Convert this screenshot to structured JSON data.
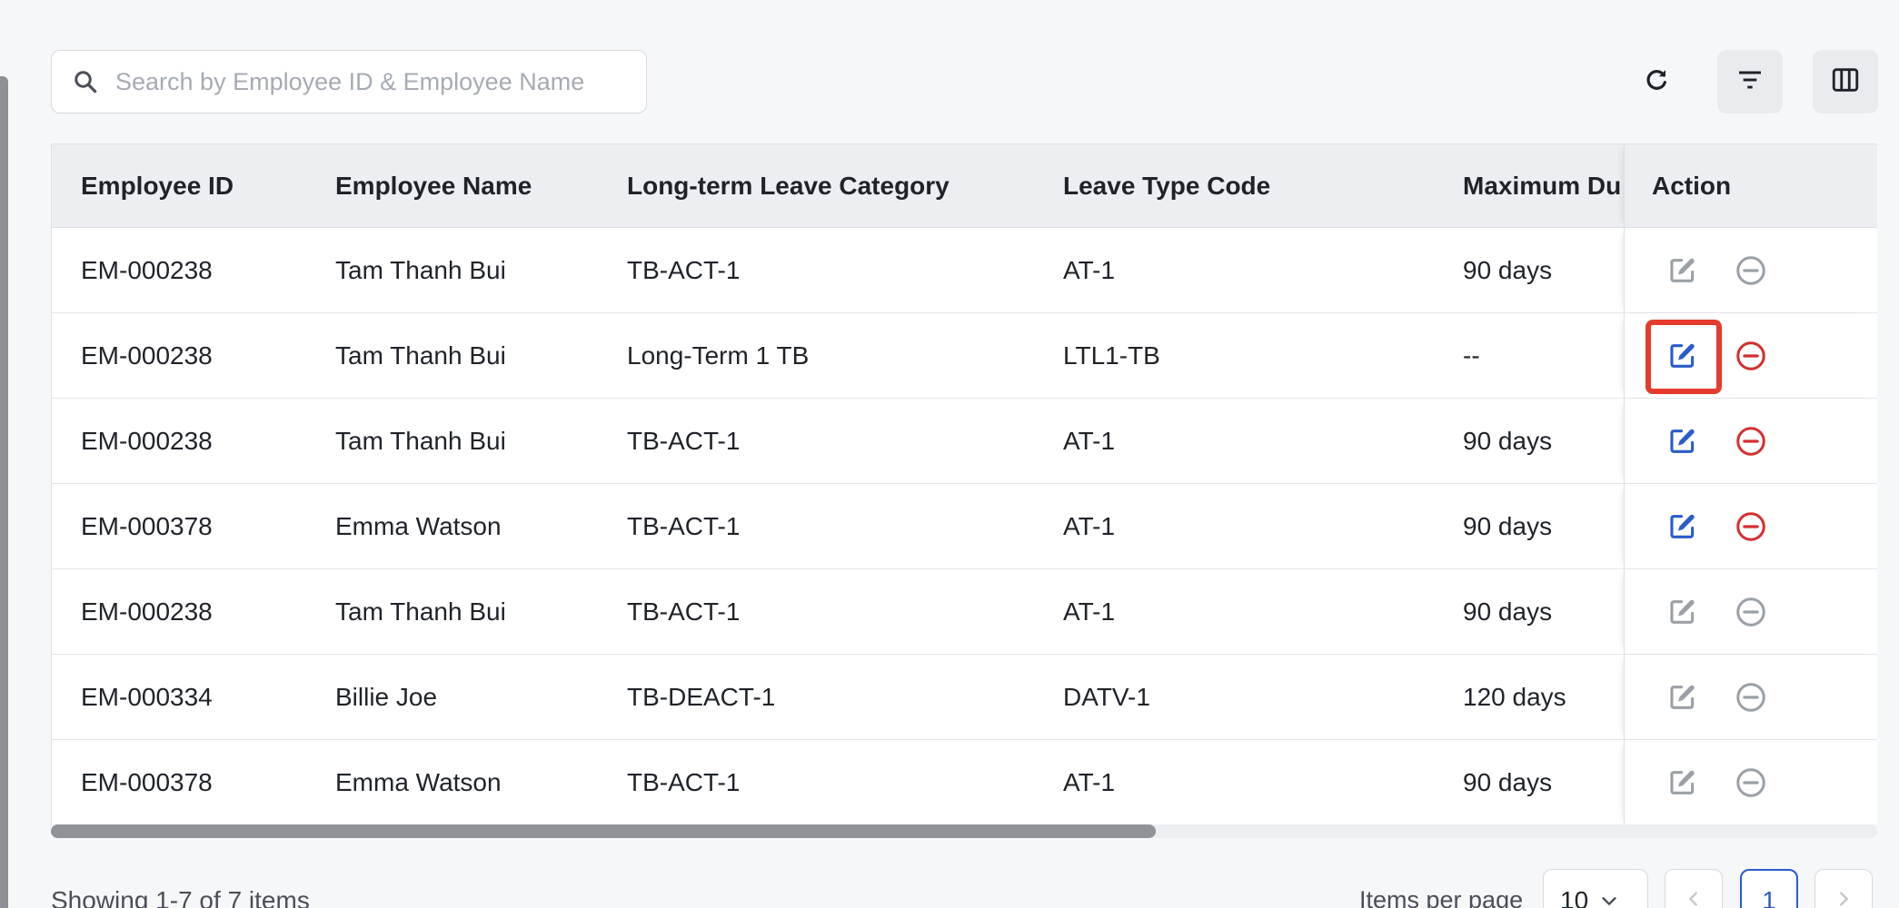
{
  "search": {
    "placeholder": "Search by Employee ID & Employee Name",
    "value": ""
  },
  "toolbar": {
    "refresh_icon": "refresh-icon",
    "filter_icon": "filter-icon",
    "columns_icon": "columns-icon"
  },
  "table": {
    "columns": [
      "Employee ID",
      "Employee Name",
      "Long-term Leave Category",
      "Leave Type Code",
      "Maximum Dur",
      "Action"
    ],
    "rows": [
      {
        "employee_id": "EM-000238",
        "employee_name": "Tam Thanh Bui",
        "category": "TB-ACT-1",
        "leave_type_code": "AT-1",
        "max_duration": "90 days",
        "actions_enabled": false
      },
      {
        "employee_id": "EM-000238",
        "employee_name": "Tam Thanh Bui",
        "category": "Long-Term 1 TB",
        "leave_type_code": "LTL1-TB",
        "max_duration": "--",
        "actions_enabled": true
      },
      {
        "employee_id": "EM-000238",
        "employee_name": "Tam Thanh Bui",
        "category": "TB-ACT-1",
        "leave_type_code": "AT-1",
        "max_duration": "90 days",
        "actions_enabled": true
      },
      {
        "employee_id": "EM-000378",
        "employee_name": "Emma Watson",
        "category": "TB-ACT-1",
        "leave_type_code": "AT-1",
        "max_duration": "90 days",
        "actions_enabled": true
      },
      {
        "employee_id": "EM-000238",
        "employee_name": "Tam Thanh Bui",
        "category": "TB-ACT-1",
        "leave_type_code": "AT-1",
        "max_duration": "90 days",
        "actions_enabled": false
      },
      {
        "employee_id": "EM-000334",
        "employee_name": "Billie Joe",
        "category": "TB-DEACT-1",
        "leave_type_code": "DATV-1",
        "max_duration": "120 days",
        "actions_enabled": false
      },
      {
        "employee_id": "EM-000378",
        "employee_name": "Emma Watson",
        "category": "TB-ACT-1",
        "leave_type_code": "AT-1",
        "max_duration": "90 days",
        "actions_enabled": false
      }
    ],
    "highlighted_row": 1
  },
  "footer": {
    "showing_text": "Showing 1-7 of 7 items",
    "items_per_page_label": "Items per page",
    "items_per_page_value": "10",
    "current_page": "1"
  },
  "colors": {
    "edit_active": "#2a5bc9",
    "remove_active": "#d32f2f",
    "icon_disabled": "#9aa0a6",
    "highlight": "#e53b2e"
  }
}
